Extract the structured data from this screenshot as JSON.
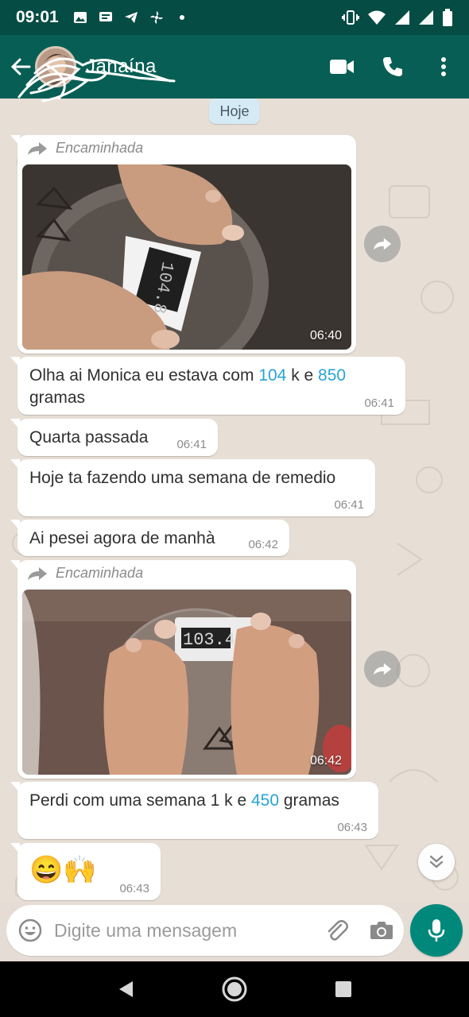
{
  "status_bar": {
    "time": "09:01",
    "icons": [
      "image-icon",
      "message-icon",
      "telegram-icon",
      "fan-icon",
      "dot-icon"
    ],
    "right_icons": [
      "vibrate-icon",
      "wifi-icon",
      "signal-icon",
      "signal-icon",
      "battery-icon"
    ]
  },
  "header": {
    "contact_name": "Janaína",
    "icons": [
      "back-arrow-icon",
      "avatar",
      "video-call-icon",
      "phone-icon",
      "more-vert-icon"
    ]
  },
  "chat": {
    "date_chip": "Hoje",
    "messages": [
      {
        "type": "image",
        "forwarded_label": "Encaminhada",
        "time": "06:40"
      },
      {
        "type": "text",
        "parts": [
          "Olha ai Monica eu estava com ",
          "104",
          " k e ",
          "850",
          "gramas"
        ],
        "time": "06:41"
      },
      {
        "type": "text",
        "text": "Quarta passada",
        "time": "06:41"
      },
      {
        "type": "text",
        "text": "Hoje ta fazendo uma semana de remedio",
        "time": "06:41"
      },
      {
        "type": "text",
        "text": "Ai pesei agora de manhà",
        "time": "06:42"
      },
      {
        "type": "image",
        "forwarded_label": "Encaminhada",
        "time": "06:42"
      },
      {
        "type": "text",
        "parts": [
          "Perdi com uma semana 1 k e ",
          "450",
          " gramas"
        ],
        "time": "06:43"
      },
      {
        "type": "text",
        "text": "😄🙌",
        "time": "06:43"
      }
    ]
  },
  "input": {
    "placeholder": "Digite uma mensagem"
  },
  "colors": {
    "header": "#075e54",
    "status_bar": "#054c44",
    "mic_button": "#00897b",
    "link_number": "#28a3d8",
    "chat_bg": "#e7ded5"
  }
}
